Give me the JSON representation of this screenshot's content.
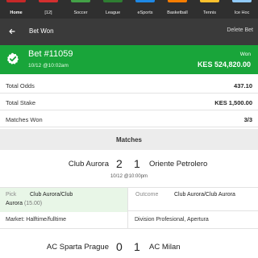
{
  "topnav": {
    "tabs": [
      {
        "label": "Home",
        "icon": "home-icon",
        "stripe": "#c62828",
        "active": true
      },
      {
        "label": "[12]",
        "icon": "betslip-icon",
        "stripe": "#d32f2f",
        "active": false
      },
      {
        "label": "Soccer",
        "icon": "soccer-icon",
        "stripe": "#43a047",
        "active": false
      },
      {
        "label": "League",
        "icon": "league-icon",
        "stripe": "#2e7d32",
        "active": false
      },
      {
        "label": "eSports",
        "icon": "esports-icon",
        "stripe": "#1e88e5",
        "active": false
      },
      {
        "label": "Basketball",
        "icon": "basketball-icon",
        "stripe": "#f57c00",
        "active": false
      },
      {
        "label": "Tennis",
        "icon": "tennis-icon",
        "stripe": "#fbc02d",
        "active": false
      },
      {
        "label": "Ice Hoc",
        "icon": "ice-hockey-icon",
        "stripe": "#90caf9",
        "active": false
      }
    ]
  },
  "header": {
    "title": "Bet Won",
    "delete_label": "Delete Bet"
  },
  "bet": {
    "id": "Bet #11059",
    "time": "10/12 @10:02am",
    "won_label": "Won",
    "won_amount": "KES 524,820.00"
  },
  "stats": [
    {
      "label": "Total Odds",
      "value": "437.10"
    },
    {
      "label": "Total Stake",
      "value": "KES 1,500.00"
    },
    {
      "label": "Matches Won",
      "value": "3/3"
    }
  ],
  "matches_title": "Matches",
  "matches": [
    {
      "home": "Club Aurora",
      "home_score": "2",
      "away_score": "1",
      "away": "Oriente Petrolero",
      "time": "10/12  @10:00pm",
      "pick_label": "Pick",
      "pick_line1": "Club Aurora/Club",
      "pick_line2": "Aurora",
      "pick_odds": " (15.00)",
      "outcome_label": "Outcome",
      "outcome": "Club Aurora/Club Aurora",
      "market": "Market: Halftime/fulltime",
      "league": "Division Profesional, Apertura"
    },
    {
      "home": "AC Sparta Prague",
      "home_score": "0",
      "away_score": "1",
      "away": "AC Milan"
    }
  ],
  "colors": {
    "topnav_bg": "#2f2f2f",
    "header_bg": "#3a3a3a",
    "won_green": "#19a53a",
    "pick_bg": "#e8f6e7"
  }
}
